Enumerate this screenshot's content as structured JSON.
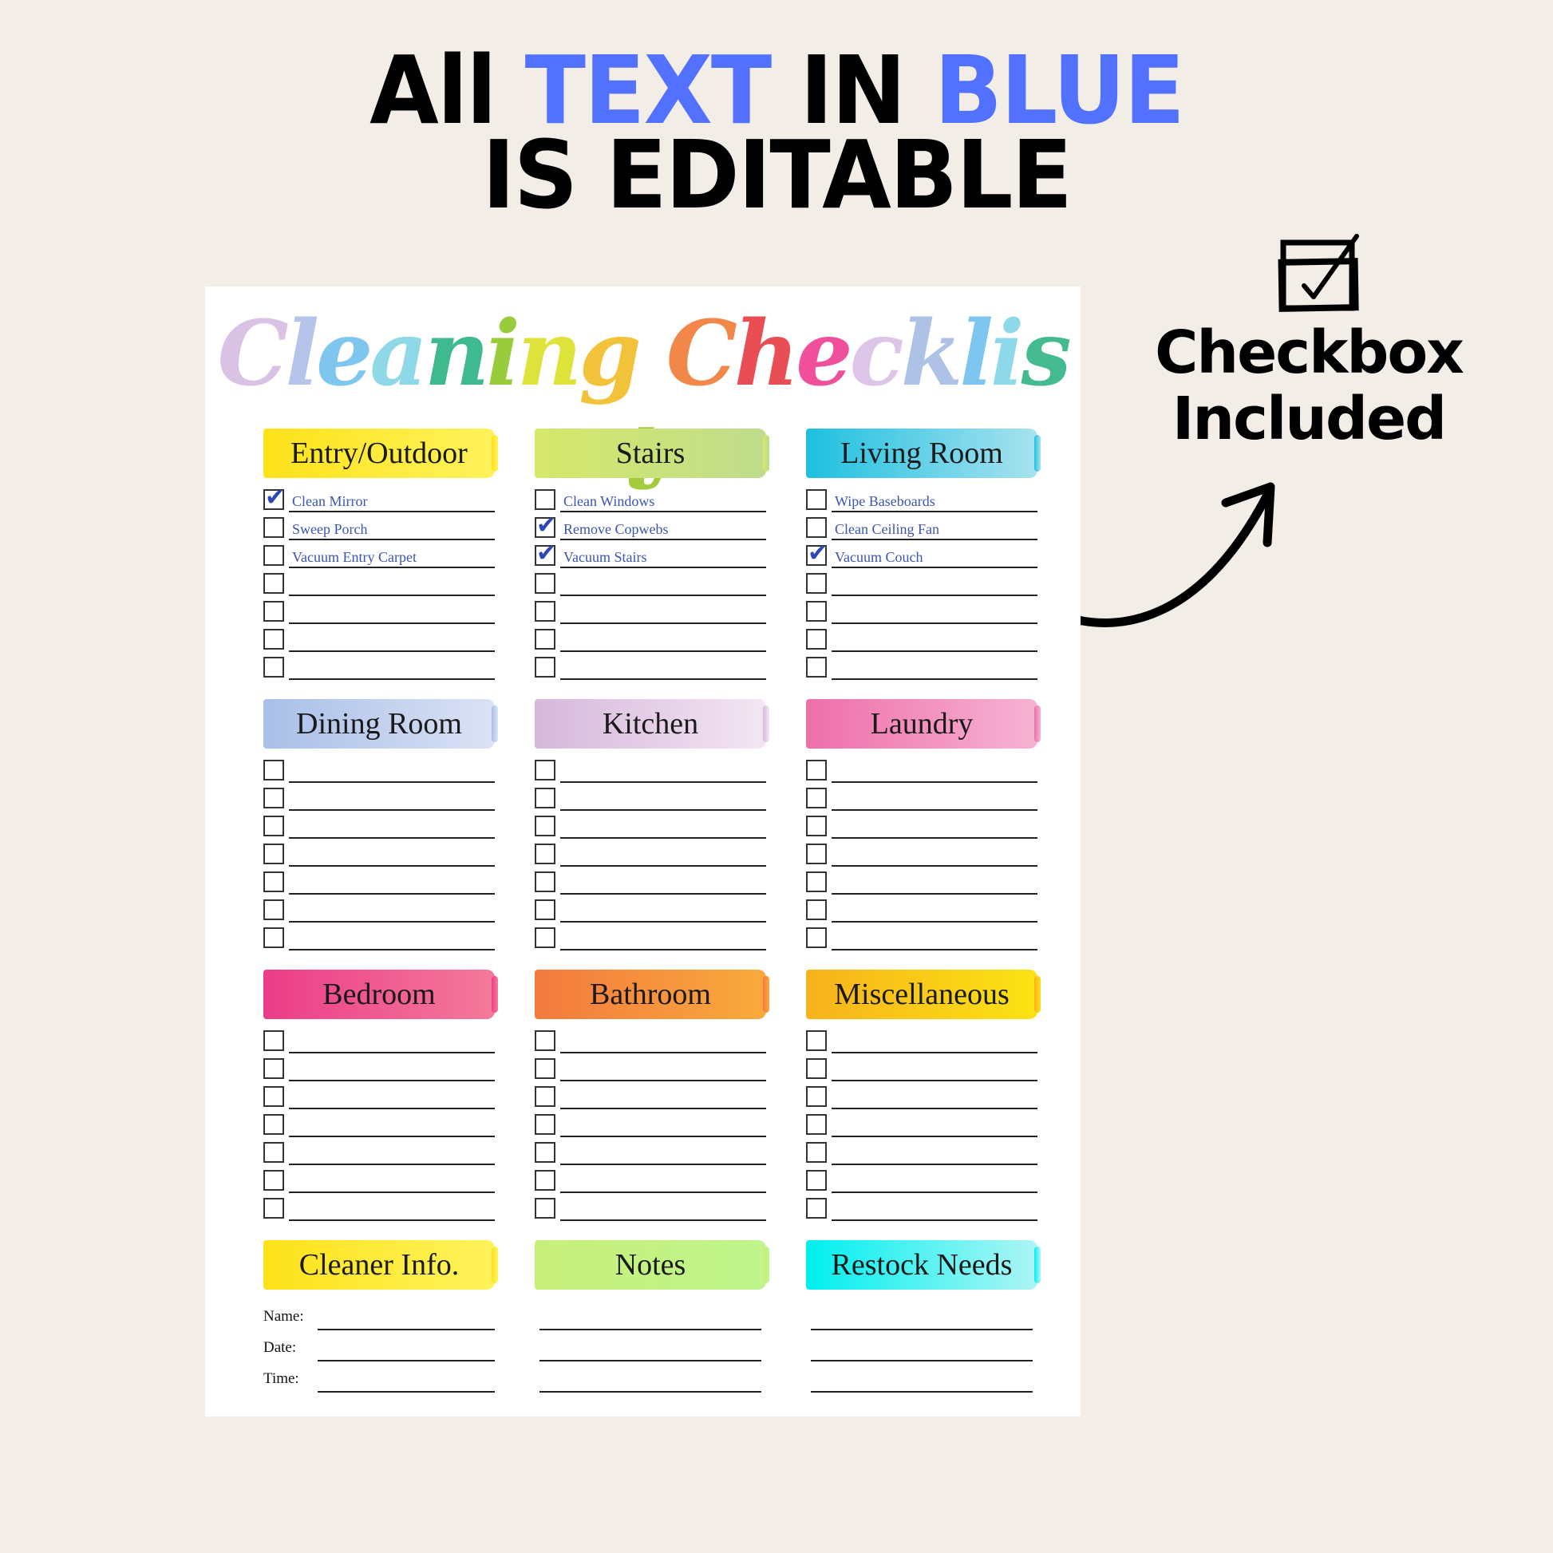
{
  "headline": {
    "line1": [
      {
        "text": "All ",
        "blue": false
      },
      {
        "text": "TEXT",
        "blue": true
      },
      {
        "text": " IN ",
        "blue": false
      },
      {
        "text": "BLUE",
        "blue": true
      }
    ],
    "line2": "IS EDITABLE"
  },
  "side_note": {
    "icon": "checkbox-checked-icon",
    "line1": "Checkbox",
    "line2": "Included",
    "arrow_icon": "curved-arrow-icon"
  },
  "colors": {
    "accent_blue": "#5271ff",
    "editable_text": "#3b55b0",
    "background": "#f2ede7"
  },
  "checklist": {
    "title": "Cleaning Checklist",
    "sections": [
      {
        "name": "Entry/Outdoor",
        "color": [
          "#fde21a",
          "#fff35c"
        ],
        "items": [
          {
            "text": "Clean Mirror",
            "checked": true
          },
          {
            "text": "Sweep Porch",
            "checked": false
          },
          {
            "text": "Vacuum Entry Carpet",
            "checked": false
          },
          {
            "text": "",
            "checked": false
          },
          {
            "text": "",
            "checked": false
          },
          {
            "text": "",
            "checked": false
          },
          {
            "text": "",
            "checked": false
          }
        ]
      },
      {
        "name": "Stairs",
        "color": [
          "#d6e86a",
          "#bfdc8c"
        ],
        "items": [
          {
            "text": "Clean Windows",
            "checked": false
          },
          {
            "text": "Remove Copwebs",
            "checked": true
          },
          {
            "text": "Vacuum Stairs",
            "checked": true
          },
          {
            "text": "",
            "checked": false
          },
          {
            "text": "",
            "checked": false
          },
          {
            "text": "",
            "checked": false
          },
          {
            "text": "",
            "checked": false
          }
        ]
      },
      {
        "name": "Living Room",
        "color": [
          "#1ec0e0",
          "#a8e2ef"
        ],
        "items": [
          {
            "text": "Wipe Baseboards",
            "checked": false
          },
          {
            "text": "Clean Ceiling Fan",
            "checked": false
          },
          {
            "text": "Vacuum Couch",
            "checked": true
          },
          {
            "text": "",
            "checked": false
          },
          {
            "text": "",
            "checked": false
          },
          {
            "text": "",
            "checked": false
          },
          {
            "text": "",
            "checked": false
          }
        ]
      },
      {
        "name": "Dining Room",
        "color": [
          "#a9bfe8",
          "#dbe2f4"
        ],
        "items": [
          {
            "text": "",
            "checked": false
          },
          {
            "text": "",
            "checked": false
          },
          {
            "text": "",
            "checked": false
          },
          {
            "text": "",
            "checked": false
          },
          {
            "text": "",
            "checked": false
          },
          {
            "text": "",
            "checked": false
          },
          {
            "text": "",
            "checked": false
          }
        ]
      },
      {
        "name": "Kitchen",
        "color": [
          "#d6b8dc",
          "#f3e6f2"
        ],
        "items": [
          {
            "text": "",
            "checked": false
          },
          {
            "text": "",
            "checked": false
          },
          {
            "text": "",
            "checked": false
          },
          {
            "text": "",
            "checked": false
          },
          {
            "text": "",
            "checked": false
          },
          {
            "text": "",
            "checked": false
          },
          {
            "text": "",
            "checked": false
          }
        ]
      },
      {
        "name": "Laundry",
        "color": [
          "#ee6fa9",
          "#f7b3d3"
        ],
        "items": [
          {
            "text": "",
            "checked": false
          },
          {
            "text": "",
            "checked": false
          },
          {
            "text": "",
            "checked": false
          },
          {
            "text": "",
            "checked": false
          },
          {
            "text": "",
            "checked": false
          },
          {
            "text": "",
            "checked": false
          },
          {
            "text": "",
            "checked": false
          }
        ]
      },
      {
        "name": "Bedroom",
        "color": [
          "#ec3c88",
          "#f47a9a"
        ],
        "items": [
          {
            "text": "",
            "checked": false
          },
          {
            "text": "",
            "checked": false
          },
          {
            "text": "",
            "checked": false
          },
          {
            "text": "",
            "checked": false
          },
          {
            "text": "",
            "checked": false
          },
          {
            "text": "",
            "checked": false
          },
          {
            "text": "",
            "checked": false
          }
        ]
      },
      {
        "name": "Bathroom",
        "color": [
          "#f37a3e",
          "#f9aa3c"
        ],
        "items": [
          {
            "text": "",
            "checked": false
          },
          {
            "text": "",
            "checked": false
          },
          {
            "text": "",
            "checked": false
          },
          {
            "text": "",
            "checked": false
          },
          {
            "text": "",
            "checked": false
          },
          {
            "text": "",
            "checked": false
          },
          {
            "text": "",
            "checked": false
          }
        ]
      },
      {
        "name": "Miscellaneous",
        "color": [
          "#f8b21c",
          "#fbe313"
        ],
        "items": [
          {
            "text": "",
            "checked": false
          },
          {
            "text": "",
            "checked": false
          },
          {
            "text": "",
            "checked": false
          },
          {
            "text": "",
            "checked": false
          },
          {
            "text": "",
            "checked": false
          },
          {
            "text": "",
            "checked": false
          },
          {
            "text": "",
            "checked": false
          }
        ]
      }
    ],
    "bottom": [
      {
        "name": "Cleaner Info.",
        "color": [
          "#fde21a",
          "#fff35c"
        ],
        "fields": [
          {
            "label": "Name:",
            "value": ""
          },
          {
            "label": "Date:",
            "value": ""
          },
          {
            "label": "Time:",
            "value": ""
          }
        ]
      },
      {
        "name": "Notes",
        "color": [
          "#c8ef7a",
          "#bff58c"
        ],
        "fields": [
          {
            "label": "",
            "value": ""
          },
          {
            "label": "",
            "value": ""
          },
          {
            "label": "",
            "value": ""
          }
        ]
      },
      {
        "name": "Restock Needs",
        "color": [
          "#00efef",
          "#aef5f5"
        ],
        "fields": [
          {
            "label": "",
            "value": ""
          },
          {
            "label": "",
            "value": ""
          },
          {
            "label": "",
            "value": ""
          }
        ]
      }
    ]
  }
}
